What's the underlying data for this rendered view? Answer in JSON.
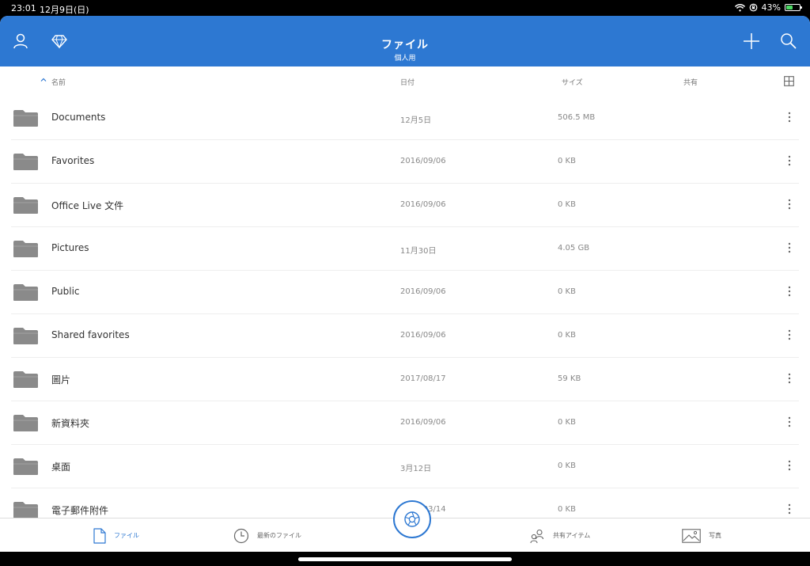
{
  "status_bar": {
    "time": "23:01",
    "date": "12月9日(日)",
    "battery": "43%"
  },
  "header": {
    "title": "ファイル",
    "subtitle": "個人用"
  },
  "columns": {
    "name": "名前",
    "date": "日付",
    "size": "サイズ",
    "shared": "共有"
  },
  "files": [
    {
      "name": "Documents",
      "date": "12月5日",
      "size": "506.5 MB"
    },
    {
      "name": "Favorites",
      "date": "2016/09/06",
      "size": "0 KB"
    },
    {
      "name": "Office Live 文件",
      "date": "2016/09/06",
      "size": "0 KB"
    },
    {
      "name": "Pictures",
      "date": "11月30日",
      "size": "4.05 GB"
    },
    {
      "name": "Public",
      "date": "2016/09/06",
      "size": "0 KB"
    },
    {
      "name": "Shared favorites",
      "date": "2016/09/06",
      "size": "0 KB"
    },
    {
      "name": "圖片",
      "date": "2017/08/17",
      "size": "59 KB"
    },
    {
      "name": "新資料夾",
      "date": "2016/09/06",
      "size": "0 KB"
    },
    {
      "name": "桌面",
      "date": "3月12日",
      "size": "0 KB"
    },
    {
      "name": "電子郵件附件",
      "date": "2017/03/14",
      "size": "0 KB"
    }
  ],
  "tabs": {
    "files": "ファイル",
    "recent": "最新のファイル",
    "shared": "共有アイテム",
    "photos": "写真"
  },
  "colors": {
    "accent": "#2d78d2",
    "folder": "#8a8a8a"
  }
}
